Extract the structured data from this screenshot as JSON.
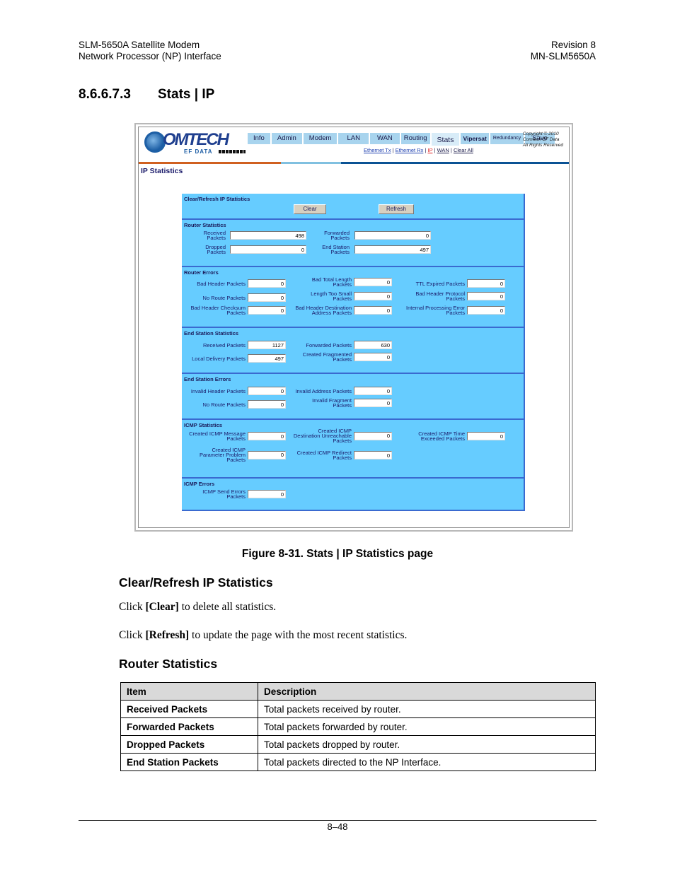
{
  "doc_header": {
    "left_line1": "SLM-5650A Satellite Modem",
    "left_line2": "Network Processor (NP) Interface",
    "right_line1": "Revision 8",
    "right_line2": "MN-SLM5650A"
  },
  "section": {
    "number": "8.6.6.7.3",
    "title": "Stats | IP"
  },
  "screenshot": {
    "logo": {
      "word": "OMTECH",
      "sub": "EF DATA"
    },
    "nav_tabs": [
      "Info",
      "Admin",
      "Modem",
      "LAN",
      "WAN",
      "Routing",
      "Stats",
      "Vipersat",
      "Redundancy",
      "Save"
    ],
    "active_tab": "Stats",
    "subnav": [
      "Ethernet Tx",
      "Ethernet Rx",
      "IP",
      "WAN",
      "Clear All"
    ],
    "active_subnav": "IP",
    "copyright": [
      "Copyright © 2010",
      "Comtech EF Data",
      "All Rights Reserved"
    ],
    "page_heading": "IP Statistics",
    "clear_refresh": {
      "title": "Clear/Refresh IP Statistics",
      "clear_label": "Clear",
      "refresh_label": "Refresh"
    },
    "router_statistics": {
      "title": "Router Statistics",
      "fields": [
        {
          "label": "Received\nPackets",
          "value": "498"
        },
        {
          "label": "Forwarded\nPackets",
          "value": "0"
        },
        {
          "label": "Dropped\nPackets",
          "value": "0"
        },
        {
          "label": "End Station\nPackets",
          "value": "497"
        }
      ]
    },
    "router_errors": {
      "title": "Router Errors",
      "fields": [
        {
          "label": "Bad Header Packets",
          "value": "0"
        },
        {
          "label": "Bad Total Length\nPackets",
          "value": "0"
        },
        {
          "label": "TTL Expired Packets",
          "value": "0"
        },
        {
          "label": "No Route Packets",
          "value": "0"
        },
        {
          "label": "Length Too Small\nPackets",
          "value": "0"
        },
        {
          "label": "Bad Header Protocol\nPackets",
          "value": "0"
        },
        {
          "label": "Bad Header Checksum\nPackets",
          "value": "0"
        },
        {
          "label": "Bad Header Destination\nAddress Packets",
          "value": "0"
        },
        {
          "label": "Internal Processing Error\nPackets",
          "value": "0"
        }
      ]
    },
    "end_station_statistics": {
      "title": "End Station Statistics",
      "fields": [
        {
          "label": "Received Packets",
          "value": "1127"
        },
        {
          "label": "Forwarded Packets",
          "value": "630"
        },
        {
          "label": "Local Delivery Packets",
          "value": "497"
        },
        {
          "label": "Created Fragmented\nPackets",
          "value": "0"
        }
      ]
    },
    "end_station_errors": {
      "title": "End Station Errors",
      "fields": [
        {
          "label": "Invalid Header Packets",
          "value": "0"
        },
        {
          "label": "Invalid Address Packets",
          "value": "0"
        },
        {
          "label": "No Route Packets",
          "value": "0"
        },
        {
          "label": "Invalid Fragment\nPackets",
          "value": "0"
        }
      ]
    },
    "icmp_statistics": {
      "title": "ICMP Statistics",
      "fields": [
        {
          "label": "Created ICMP Message\nPackets",
          "value": "0"
        },
        {
          "label": "Created ICMP\nDestination Unreachable\nPackets",
          "value": "0"
        },
        {
          "label": "Created ICMP Time\nExceeded Packets",
          "value": "0"
        },
        {
          "label": "Created ICMP\nParameter Problem\nPackets",
          "value": "0"
        },
        {
          "label": "Created ICMP Redirect\nPackets",
          "value": "0"
        }
      ]
    },
    "icmp_errors": {
      "title": "ICMP Errors",
      "fields": [
        {
          "label": "ICMP Send Errors\nPackets",
          "value": "0"
        }
      ]
    }
  },
  "figure_caption": "Figure 8-31. Stats | IP Statistics page",
  "clear_refresh_section": {
    "heading": "Clear/Refresh IP Statistics",
    "para1": {
      "pre": "Click ",
      "bold": "[Clear]",
      "post": " to delete all statistics."
    },
    "para2": {
      "pre": "Click ",
      "bold": "[Refresh]",
      "post": " to update the page with the most recent statistics."
    }
  },
  "router_section": {
    "heading": "Router Statistics",
    "table": {
      "headers": [
        "Item",
        "Description"
      ],
      "rows": [
        [
          "Received Packets",
          "Total packets received by router."
        ],
        [
          "Forwarded Packets",
          "Total packets forwarded by router."
        ],
        [
          "Dropped Packets",
          "Total packets dropped by router."
        ],
        [
          "End Station Packets",
          "Total packets directed to the NP Interface."
        ]
      ]
    }
  },
  "footer": {
    "page_number": "8–48"
  }
}
